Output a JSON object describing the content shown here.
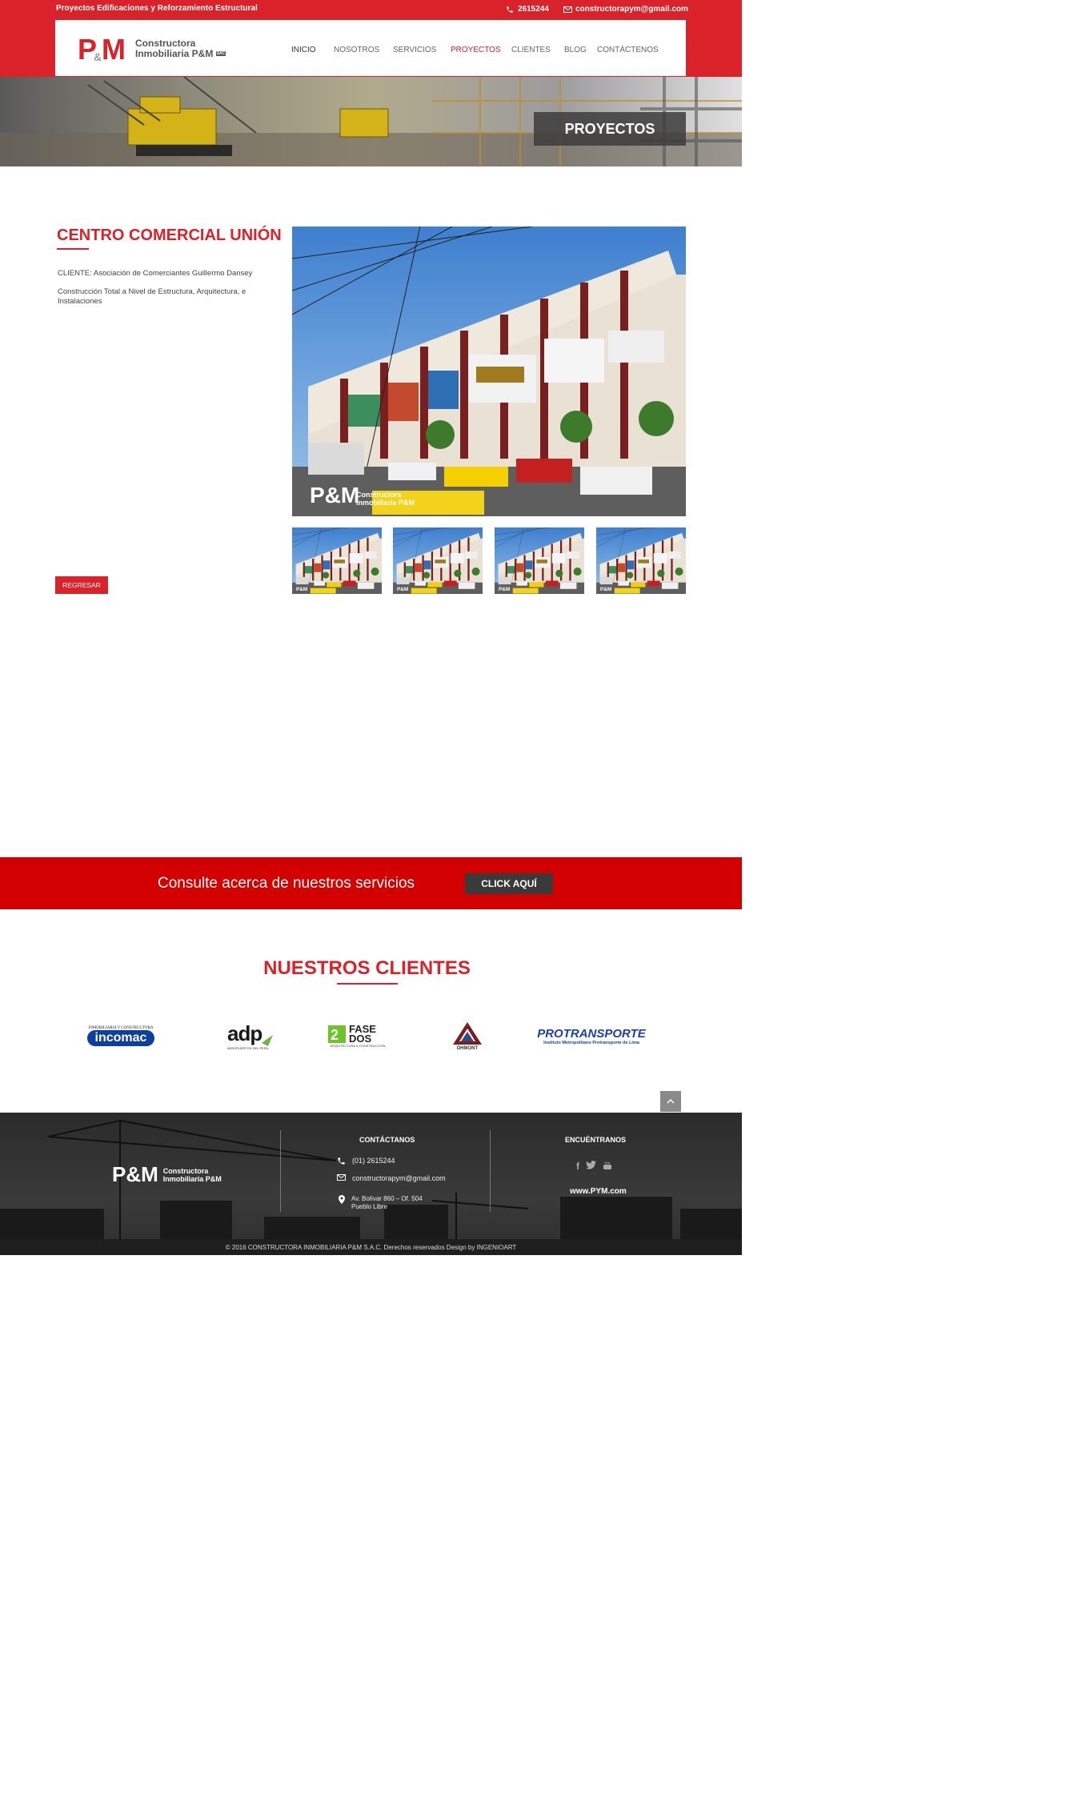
{
  "topbar": {
    "tagline": "Proyectos Edificaciones y Reforzamiento Estructural",
    "phone": "2615244",
    "email": "constructorapym@gmail.com"
  },
  "brand": {
    "line1": "Constructora",
    "line2": "Inmobiliaria P&M",
    "suffix": "SAC",
    "mark_text": "P&M",
    "accent": "#d9222a"
  },
  "nav": {
    "items": [
      {
        "label": "INICIO",
        "active": false
      },
      {
        "label": "NOSOTROS",
        "active": false
      },
      {
        "label": "SERVICIOS",
        "active": false
      },
      {
        "label": "PROYECTOS",
        "active": true
      },
      {
        "label": "CLIENTES",
        "active": false
      },
      {
        "label": "BLOG",
        "active": false
      },
      {
        "label": "CONTÁCTENOS",
        "active": false
      }
    ]
  },
  "banner": {
    "title": "PROYECTOS"
  },
  "project": {
    "title": "CENTRO COMERCIAL UNIÓN",
    "client": "CLIENTE: Asociación de Comerciantes Guillermo Dansey",
    "description": "Construcción Total a Nivel de Estructura, Arquitectura, e Instalaciones",
    "back_label": "REGRESAR",
    "watermark_line1": "Constructora",
    "watermark_line2": "Inmobiliaria P&M",
    "thumbnail_count": 4
  },
  "cta": {
    "text": "Consulte acerca de nuestros servicios",
    "button": "CLICK AQUÍ"
  },
  "clients": {
    "title": "NUESTROS CLIENTES",
    "logos": [
      {
        "top": "INMOBILIARIA Y CONSTRUCTORA",
        "name": "incomac"
      },
      {
        "name": "adp",
        "sub": "AEROPUERTOS DEL PERU"
      },
      {
        "name": "FASE DOS",
        "sub": "ARQUITECTURA & CONSTRUCCIÓN"
      },
      {
        "name": "DHMONT",
        "sub": "CONSTRUCTORA"
      },
      {
        "name": "PROTRANSPORTE",
        "sub": "Instituto Metropolitano Protransporte de Lima"
      }
    ]
  },
  "footer": {
    "contact_title": "CONTÁCTANOS",
    "phone": "(01) 2615244",
    "email": "constructorapym@gmail.com",
    "address_line1": "Av. Bolívar 860 – Of. 504",
    "address_line2": "Pueblo Libre",
    "social_title": "ENCUÉNTRANOS",
    "site": "www.PYM.com",
    "copyright": "© 2016  CONSTRUCTORA INMOBILIARIA P&M S.A.C.   Derechos reservados Design by INGENIOART"
  }
}
